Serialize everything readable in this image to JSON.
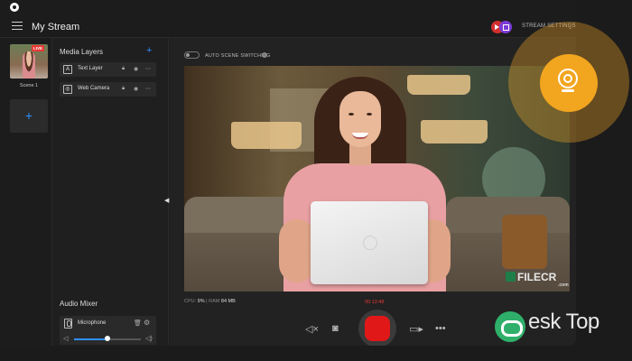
{
  "app": {
    "title": "My Stream"
  },
  "header": {
    "stream_settings_label": "STREAM SETTINGS",
    "platforms": [
      "youtube-icon",
      "twitch-icon"
    ]
  },
  "scenes": {
    "items": [
      {
        "label": "Scene 1",
        "badge": "LIVE"
      }
    ],
    "add_label": "+"
  },
  "media_layers": {
    "title": "Media Layers",
    "add_label": "+",
    "items": [
      {
        "label": "Text Layer",
        "icon": "A"
      },
      {
        "label": "Web Camera",
        "icon": "◎"
      }
    ]
  },
  "audio_mixer": {
    "title": "Audio Mixer",
    "channels": [
      {
        "label": "Microphone",
        "volume_fraction": 0.5
      }
    ]
  },
  "preview": {
    "auto_scene_label": "AUTO SCENE SWITCHING",
    "auto_scene_enabled": false,
    "watermark_text": "FILECR",
    "watermark_sub": ".com"
  },
  "stats": {
    "cpu_label": "CPU:",
    "cpu_value": "9%",
    "ram_label": "RAM",
    "ram_value": "84 MB",
    "timer": "00:12:48"
  },
  "controls": {
    "mute_icon": "speaker-muted-icon",
    "snapshot_icon": "camera-icon",
    "video_icon": "video-camera-icon",
    "more_icon": "more-icon"
  },
  "overlay_watermark": "esk Top",
  "colors": {
    "accent": "#2e8fff",
    "record": "#e01818",
    "highlight": "#f2a51f",
    "live": "#e53935"
  }
}
